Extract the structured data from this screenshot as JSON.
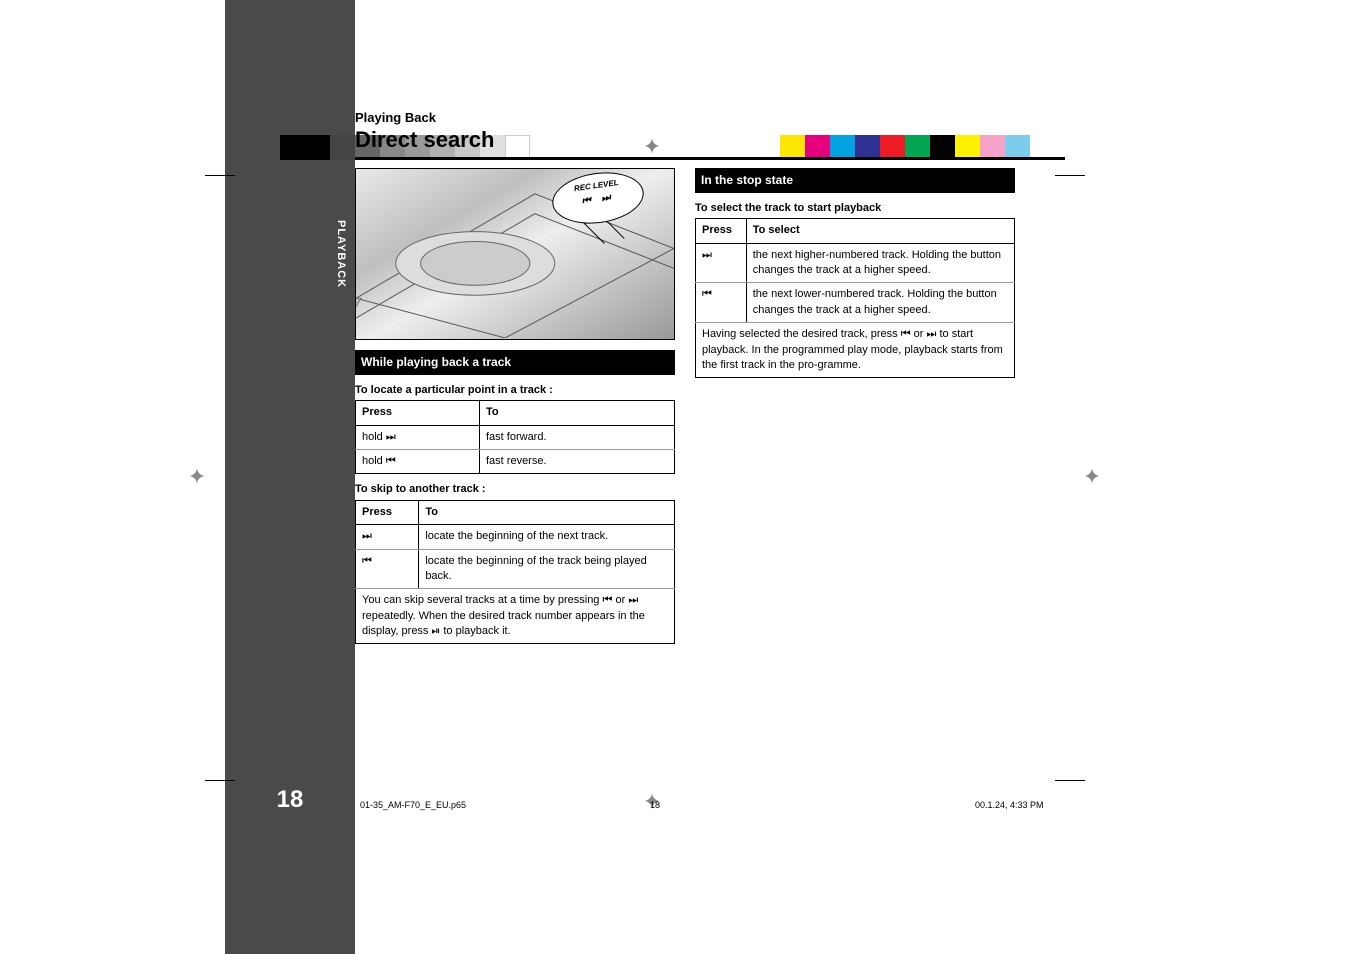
{
  "page_number": "18",
  "sidebar_tab": "PLAYBACK",
  "category": "Playing Back",
  "title": "Direct search",
  "device": {
    "callout": "REC LEVEL"
  },
  "section1": {
    "heading": "While playing back a track",
    "sub1": "To locate a particular point in a track :",
    "table1": {
      "head_col1": "Press",
      "head_col2": "To",
      "row1_col1": "hold",
      "row1_col2": "fast forward.",
      "row2_col1": "hold",
      "row2_col2": "fast reverse."
    },
    "sub2": "To skip to another track :",
    "table2": {
      "head_col1": "Press",
      "head_col2": "To",
      "row1_col2": "locate the beginning of the next track.",
      "row2_col2": "locate the beginning of the track being played back.",
      "note": "You can skip several tracks at a time by pressing         or         repeatedly. When the desired track number appears in the display, press         to playback it."
    }
  },
  "section2": {
    "heading": "In the stop state",
    "sub1": "To select the track to start playback",
    "table1": {
      "head_col1": "Press",
      "head_col2": "To select",
      "row1_col2": "the next higher-numbered track. Holding the button changes the track at a higher speed.",
      "row2_col2": "the next lower-numbered track. Holding the button changes the track at a higher speed.",
      "note": "Having selected the desired track, press         or         to start playback. In the programmed play mode, playback starts from the first track in the pro-gramme."
    }
  },
  "footer_path": "01-35_AM-F70_E_EU.p65",
  "footer_mid": "18",
  "footer_time": "00.1.24, 4:33 PM"
}
